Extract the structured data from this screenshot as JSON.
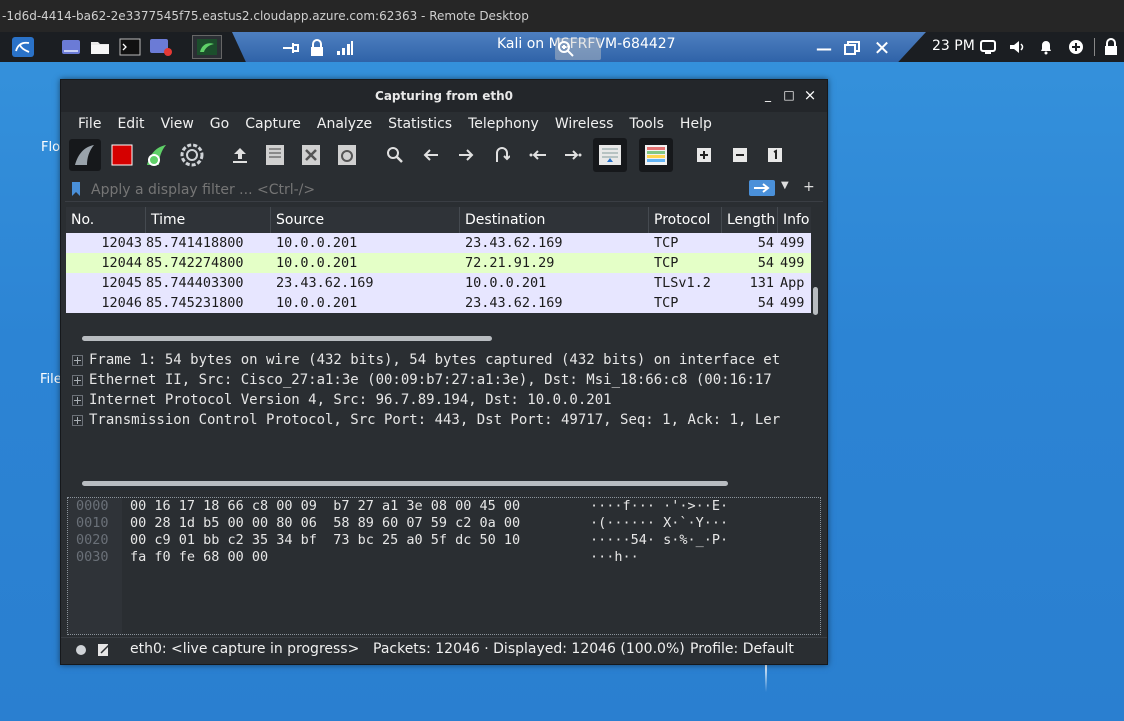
{
  "rd": {
    "title": "-1d6d-4414-ba62-2e3377545f75.eastus2.cloudapp.azure.com:62363 - Remote Desktop",
    "bar_text": "Kali on MSFRFVM-684427"
  },
  "desktop": {
    "label1": "Flo",
    "label2": "File"
  },
  "tray": {
    "time": "23 PM"
  },
  "window": {
    "title": "Capturing from eth0",
    "minimize": "_",
    "maximize": "□",
    "close": "×"
  },
  "menu": [
    "File",
    "Edit",
    "View",
    "Go",
    "Capture",
    "Analyze",
    "Statistics",
    "Telephony",
    "Wireless",
    "Tools",
    "Help"
  ],
  "filter": {
    "placeholder": "Apply a display filter ... <Ctrl-/>"
  },
  "packet_list": {
    "columns": [
      "No.",
      "Time",
      "Source",
      "Destination",
      "Protocol",
      "Length",
      "Info"
    ],
    "rows": [
      {
        "no": "12043",
        "time": "85.741418800",
        "source": "10.0.0.201",
        "destination": "23.43.62.169",
        "protocol": "TCP",
        "length": "54",
        "info": "499",
        "color": "#e7e6ff"
      },
      {
        "no": "12044",
        "time": "85.742274800",
        "source": "10.0.0.201",
        "destination": "72.21.91.29",
        "protocol": "TCP",
        "length": "54",
        "info": "499",
        "color": "#e4ffc7"
      },
      {
        "no": "12045",
        "time": "85.744403300",
        "source": "23.43.62.169",
        "destination": "10.0.0.201",
        "protocol": "TLSv1.2",
        "length": "131",
        "info": "App",
        "color": "#e7e6ff"
      },
      {
        "no": "12046",
        "time": "85.745231800",
        "source": "10.0.0.201",
        "destination": "23.43.62.169",
        "protocol": "TCP",
        "length": "54",
        "info": "499",
        "color": "#e7e6ff"
      }
    ]
  },
  "details": [
    "Frame 1: 54 bytes on wire (432 bits), 54 bytes captured (432 bits) on interface et",
    "Ethernet II, Src: Cisco_27:a1:3e (00:09:b7:27:a1:3e), Dst: Msi_18:66:c8 (00:16:17",
    "Internet Protocol Version 4, Src: 96.7.89.194, Dst: 10.0.0.201",
    "Transmission Control Protocol, Src Port: 443, Dst Port: 49717, Seq: 1, Ack: 1, Ler"
  ],
  "hex": [
    {
      "offset": "0000",
      "bytes": "00 16 17 18 66 c8 00 09  b7 27 a1 3e 08 00 45 00",
      "ascii": "····f··· ·'·>··E·"
    },
    {
      "offset": "0010",
      "bytes": "00 28 1d b5 00 00 80 06  58 89 60 07 59 c2 0a 00",
      "ascii": "·(······ X·`·Y···"
    },
    {
      "offset": "0020",
      "bytes": "00 c9 01 bb c2 35 34 bf  73 bc 25 a0 5f dc 50 10",
      "ascii": "·····54· s·%·_·P·"
    },
    {
      "offset": "0030",
      "bytes": "fa f0 fe 68 00 00",
      "ascii": "···h··"
    }
  ],
  "status": {
    "interface": "eth0: <live capture in progress>",
    "packets": "Packets: 12046 · Displayed: 12046 (100.0%)",
    "profile": "Profile: Default"
  },
  "colors": {
    "tcp_row": "#e7e6ff",
    "http_row": "#e4ffc7",
    "capture_stop": "#d50000",
    "accent": "#4a90d9"
  }
}
